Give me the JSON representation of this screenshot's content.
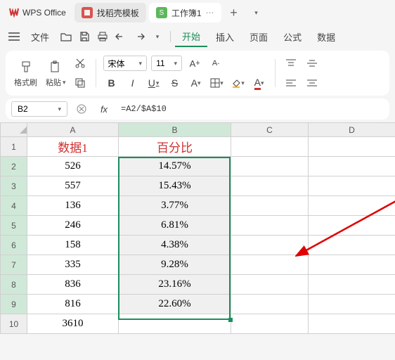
{
  "app_name": "WPS Office",
  "tabs": [
    {
      "icon": "red",
      "label": "找稻壳模板"
    },
    {
      "icon": "green",
      "icon_text": "S",
      "label": "工作簿1",
      "active": true
    }
  ],
  "menu": {
    "file": "文件",
    "items": [
      "开始",
      "插入",
      "页面",
      "公式",
      "数据"
    ]
  },
  "toolbar": {
    "format_painter": "格式刷",
    "paste": "粘贴",
    "font_name": "宋体",
    "font_size": "11",
    "bold": "B",
    "italic": "I",
    "underline": "U",
    "strike": "S"
  },
  "formula_bar": {
    "cell_ref": "B2",
    "formula": "=A2/$A$10"
  },
  "columns": [
    "A",
    "B",
    "C",
    "D"
  ],
  "headers": {
    "A": "数据1",
    "B": "百分比"
  },
  "rows": [
    {
      "n": 1
    },
    {
      "n": 2,
      "A": "526",
      "B": "14.57%"
    },
    {
      "n": 3,
      "A": "557",
      "B": "15.43%"
    },
    {
      "n": 4,
      "A": "136",
      "B": "3.77%"
    },
    {
      "n": 5,
      "A": "246",
      "B": "6.81%"
    },
    {
      "n": 6,
      "A": "158",
      "B": "4.38%"
    },
    {
      "n": 7,
      "A": "335",
      "B": "9.28%"
    },
    {
      "n": 8,
      "A": "836",
      "B": "23.16%"
    },
    {
      "n": 9,
      "A": "816",
      "B": "22.60%"
    },
    {
      "n": 10,
      "A": "3610"
    }
  ]
}
